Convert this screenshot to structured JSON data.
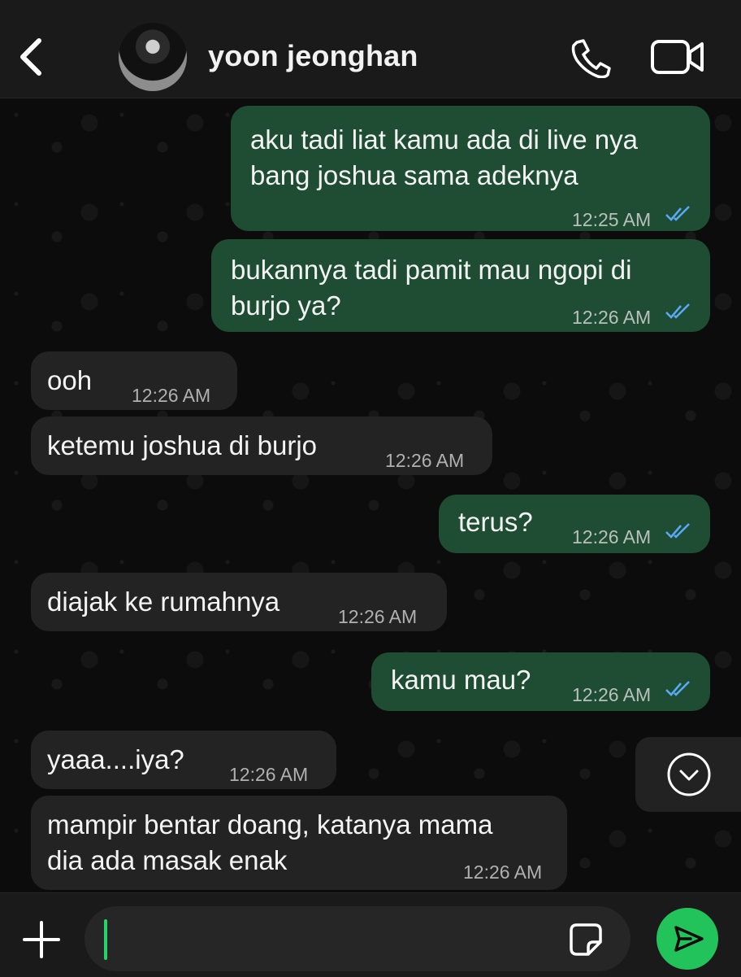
{
  "header": {
    "contact_name": "yoon jeonghan",
    "icons": [
      "back-chevron-icon",
      "avatar",
      "phone-icon",
      "video-camera-icon"
    ]
  },
  "messages": [
    {
      "dir": "out",
      "lines": [
        "aku tadi liat kamu ada di live nya",
        "bang joshua sama adeknya"
      ],
      "time": "12:25 AM",
      "status": "read"
    },
    {
      "dir": "out",
      "lines": [
        "bukannya tadi pamit mau ngopi di",
        "burjo ya?"
      ],
      "time": "12:26 AM",
      "status": "read"
    },
    {
      "dir": "in",
      "lines": [
        "ooh"
      ],
      "time": "12:26 AM"
    },
    {
      "dir": "in",
      "lines": [
        "ketemu joshua di burjo"
      ],
      "time": "12:26 AM"
    },
    {
      "dir": "out",
      "lines": [
        "terus?"
      ],
      "time": "12:26 AM",
      "status": "read"
    },
    {
      "dir": "in",
      "lines": [
        "diajak ke rumahnya"
      ],
      "time": "12:26 AM"
    },
    {
      "dir": "out",
      "lines": [
        "kamu mau?"
      ],
      "time": "12:26 AM",
      "status": "read"
    },
    {
      "dir": "in",
      "lines": [
        "yaaa....iya?"
      ],
      "time": "12:26 AM"
    },
    {
      "dir": "in",
      "lines": [
        "mampir bentar doang, katanya mama",
        "dia ada masak enak"
      ],
      "time": "12:26 AM"
    }
  ],
  "composer": {
    "input_value": "",
    "icons": [
      "plus-icon",
      "sticker-icon",
      "send-icon"
    ]
  },
  "colors": {
    "outgoing_bubble": "#1f4d33",
    "incoming_bubble": "#232323",
    "read_ticks": "#5aa9f5",
    "send_button": "#23c35b"
  }
}
